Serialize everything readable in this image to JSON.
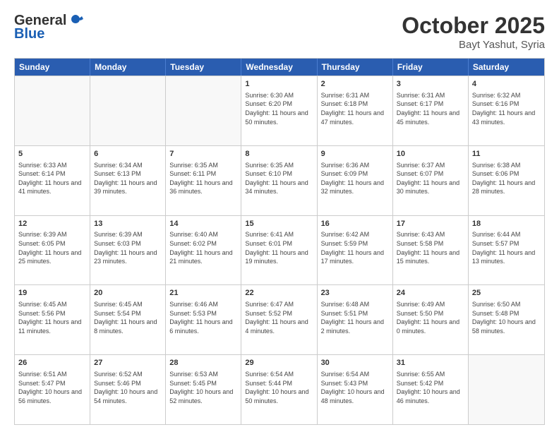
{
  "header": {
    "logo_general": "General",
    "logo_blue": "Blue",
    "month_title": "October 2025",
    "subtitle": "Bayt Yashut, Syria"
  },
  "days_of_week": [
    "Sunday",
    "Monday",
    "Tuesday",
    "Wednesday",
    "Thursday",
    "Friday",
    "Saturday"
  ],
  "weeks": [
    [
      {
        "day": "",
        "sunrise": "",
        "sunset": "",
        "daylight": "",
        "empty": true
      },
      {
        "day": "",
        "sunrise": "",
        "sunset": "",
        "daylight": "",
        "empty": true
      },
      {
        "day": "",
        "sunrise": "",
        "sunset": "",
        "daylight": "",
        "empty": true
      },
      {
        "day": "1",
        "sunrise": "Sunrise: 6:30 AM",
        "sunset": "Sunset: 6:20 PM",
        "daylight": "Daylight: 11 hours and 50 minutes.",
        "empty": false
      },
      {
        "day": "2",
        "sunrise": "Sunrise: 6:31 AM",
        "sunset": "Sunset: 6:18 PM",
        "daylight": "Daylight: 11 hours and 47 minutes.",
        "empty": false
      },
      {
        "day": "3",
        "sunrise": "Sunrise: 6:31 AM",
        "sunset": "Sunset: 6:17 PM",
        "daylight": "Daylight: 11 hours and 45 minutes.",
        "empty": false
      },
      {
        "day": "4",
        "sunrise": "Sunrise: 6:32 AM",
        "sunset": "Sunset: 6:16 PM",
        "daylight": "Daylight: 11 hours and 43 minutes.",
        "empty": false
      }
    ],
    [
      {
        "day": "5",
        "sunrise": "Sunrise: 6:33 AM",
        "sunset": "Sunset: 6:14 PM",
        "daylight": "Daylight: 11 hours and 41 minutes.",
        "empty": false
      },
      {
        "day": "6",
        "sunrise": "Sunrise: 6:34 AM",
        "sunset": "Sunset: 6:13 PM",
        "daylight": "Daylight: 11 hours and 39 minutes.",
        "empty": false
      },
      {
        "day": "7",
        "sunrise": "Sunrise: 6:35 AM",
        "sunset": "Sunset: 6:11 PM",
        "daylight": "Daylight: 11 hours and 36 minutes.",
        "empty": false
      },
      {
        "day": "8",
        "sunrise": "Sunrise: 6:35 AM",
        "sunset": "Sunset: 6:10 PM",
        "daylight": "Daylight: 11 hours and 34 minutes.",
        "empty": false
      },
      {
        "day": "9",
        "sunrise": "Sunrise: 6:36 AM",
        "sunset": "Sunset: 6:09 PM",
        "daylight": "Daylight: 11 hours and 32 minutes.",
        "empty": false
      },
      {
        "day": "10",
        "sunrise": "Sunrise: 6:37 AM",
        "sunset": "Sunset: 6:07 PM",
        "daylight": "Daylight: 11 hours and 30 minutes.",
        "empty": false
      },
      {
        "day": "11",
        "sunrise": "Sunrise: 6:38 AM",
        "sunset": "Sunset: 6:06 PM",
        "daylight": "Daylight: 11 hours and 28 minutes.",
        "empty": false
      }
    ],
    [
      {
        "day": "12",
        "sunrise": "Sunrise: 6:39 AM",
        "sunset": "Sunset: 6:05 PM",
        "daylight": "Daylight: 11 hours and 25 minutes.",
        "empty": false
      },
      {
        "day": "13",
        "sunrise": "Sunrise: 6:39 AM",
        "sunset": "Sunset: 6:03 PM",
        "daylight": "Daylight: 11 hours and 23 minutes.",
        "empty": false
      },
      {
        "day": "14",
        "sunrise": "Sunrise: 6:40 AM",
        "sunset": "Sunset: 6:02 PM",
        "daylight": "Daylight: 11 hours and 21 minutes.",
        "empty": false
      },
      {
        "day": "15",
        "sunrise": "Sunrise: 6:41 AM",
        "sunset": "Sunset: 6:01 PM",
        "daylight": "Daylight: 11 hours and 19 minutes.",
        "empty": false
      },
      {
        "day": "16",
        "sunrise": "Sunrise: 6:42 AM",
        "sunset": "Sunset: 5:59 PM",
        "daylight": "Daylight: 11 hours and 17 minutes.",
        "empty": false
      },
      {
        "day": "17",
        "sunrise": "Sunrise: 6:43 AM",
        "sunset": "Sunset: 5:58 PM",
        "daylight": "Daylight: 11 hours and 15 minutes.",
        "empty": false
      },
      {
        "day": "18",
        "sunrise": "Sunrise: 6:44 AM",
        "sunset": "Sunset: 5:57 PM",
        "daylight": "Daylight: 11 hours and 13 minutes.",
        "empty": false
      }
    ],
    [
      {
        "day": "19",
        "sunrise": "Sunrise: 6:45 AM",
        "sunset": "Sunset: 5:56 PM",
        "daylight": "Daylight: 11 hours and 11 minutes.",
        "empty": false
      },
      {
        "day": "20",
        "sunrise": "Sunrise: 6:45 AM",
        "sunset": "Sunset: 5:54 PM",
        "daylight": "Daylight: 11 hours and 8 minutes.",
        "empty": false
      },
      {
        "day": "21",
        "sunrise": "Sunrise: 6:46 AM",
        "sunset": "Sunset: 5:53 PM",
        "daylight": "Daylight: 11 hours and 6 minutes.",
        "empty": false
      },
      {
        "day": "22",
        "sunrise": "Sunrise: 6:47 AM",
        "sunset": "Sunset: 5:52 PM",
        "daylight": "Daylight: 11 hours and 4 minutes.",
        "empty": false
      },
      {
        "day": "23",
        "sunrise": "Sunrise: 6:48 AM",
        "sunset": "Sunset: 5:51 PM",
        "daylight": "Daylight: 11 hours and 2 minutes.",
        "empty": false
      },
      {
        "day": "24",
        "sunrise": "Sunrise: 6:49 AM",
        "sunset": "Sunset: 5:50 PM",
        "daylight": "Daylight: 11 hours and 0 minutes.",
        "empty": false
      },
      {
        "day": "25",
        "sunrise": "Sunrise: 6:50 AM",
        "sunset": "Sunset: 5:48 PM",
        "daylight": "Daylight: 10 hours and 58 minutes.",
        "empty": false
      }
    ],
    [
      {
        "day": "26",
        "sunrise": "Sunrise: 6:51 AM",
        "sunset": "Sunset: 5:47 PM",
        "daylight": "Daylight: 10 hours and 56 minutes.",
        "empty": false
      },
      {
        "day": "27",
        "sunrise": "Sunrise: 6:52 AM",
        "sunset": "Sunset: 5:46 PM",
        "daylight": "Daylight: 10 hours and 54 minutes.",
        "empty": false
      },
      {
        "day": "28",
        "sunrise": "Sunrise: 6:53 AM",
        "sunset": "Sunset: 5:45 PM",
        "daylight": "Daylight: 10 hours and 52 minutes.",
        "empty": false
      },
      {
        "day": "29",
        "sunrise": "Sunrise: 6:54 AM",
        "sunset": "Sunset: 5:44 PM",
        "daylight": "Daylight: 10 hours and 50 minutes.",
        "empty": false
      },
      {
        "day": "30",
        "sunrise": "Sunrise: 6:54 AM",
        "sunset": "Sunset: 5:43 PM",
        "daylight": "Daylight: 10 hours and 48 minutes.",
        "empty": false
      },
      {
        "day": "31",
        "sunrise": "Sunrise: 6:55 AM",
        "sunset": "Sunset: 5:42 PM",
        "daylight": "Daylight: 10 hours and 46 minutes.",
        "empty": false
      },
      {
        "day": "",
        "sunrise": "",
        "sunset": "",
        "daylight": "",
        "empty": true
      }
    ]
  ]
}
